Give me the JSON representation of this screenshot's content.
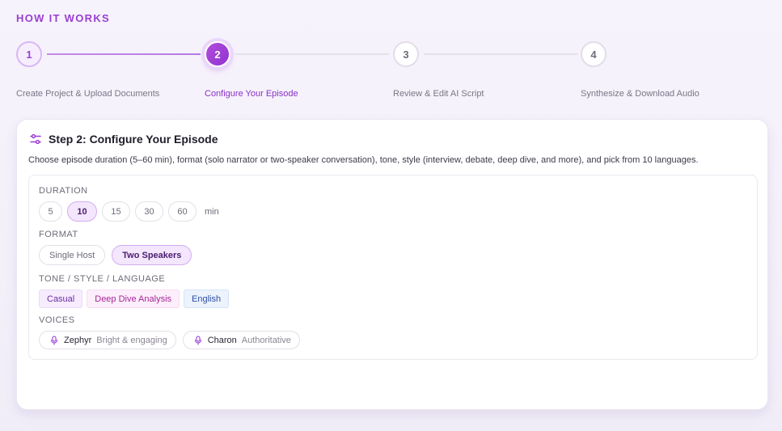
{
  "section_title": "HOW IT WORKS",
  "steps": [
    {
      "number": "1",
      "label": "Create Project & Upload Documents",
      "state": "done"
    },
    {
      "number": "2",
      "label": "Configure Your Episode",
      "state": "active"
    },
    {
      "number": "3",
      "label": "Review & Edit AI Script",
      "state": "pending"
    },
    {
      "number": "4",
      "label": "Synthesize & Download Audio",
      "state": "pending"
    }
  ],
  "card": {
    "icon": "sliders-icon",
    "title": "Step 2: Configure Your Episode",
    "description": "Choose episode duration (5–60 min), format (solo narrator or two-speaker conversation), tone, style (interview, debate, deep dive, and more), and pick from 10 languages."
  },
  "duration": {
    "label": "DURATION",
    "options": [
      "5",
      "10",
      "15",
      "30",
      "60"
    ],
    "selected": "10",
    "unit": "min"
  },
  "format": {
    "label": "FORMAT",
    "options": [
      "Single Host",
      "Two Speakers"
    ],
    "selected": "Two Speakers"
  },
  "tone_style_language": {
    "label": "TONE / STYLE / LANGUAGE",
    "tone": "Casual",
    "style": "Deep Dive Analysis",
    "language": "English"
  },
  "voices": {
    "label": "VOICES",
    "items": [
      {
        "name": "Zephyr",
        "description": "Bright & engaging",
        "icon": "microphone-icon"
      },
      {
        "name": "Charon",
        "description": "Authoritative",
        "icon": "microphone-icon"
      }
    ]
  },
  "colors": {
    "accent": "#9a3fd3",
    "tone_tag": "#6d2aa0",
    "style_tag": "#a5279a",
    "language_tag": "#2c4fa3"
  }
}
